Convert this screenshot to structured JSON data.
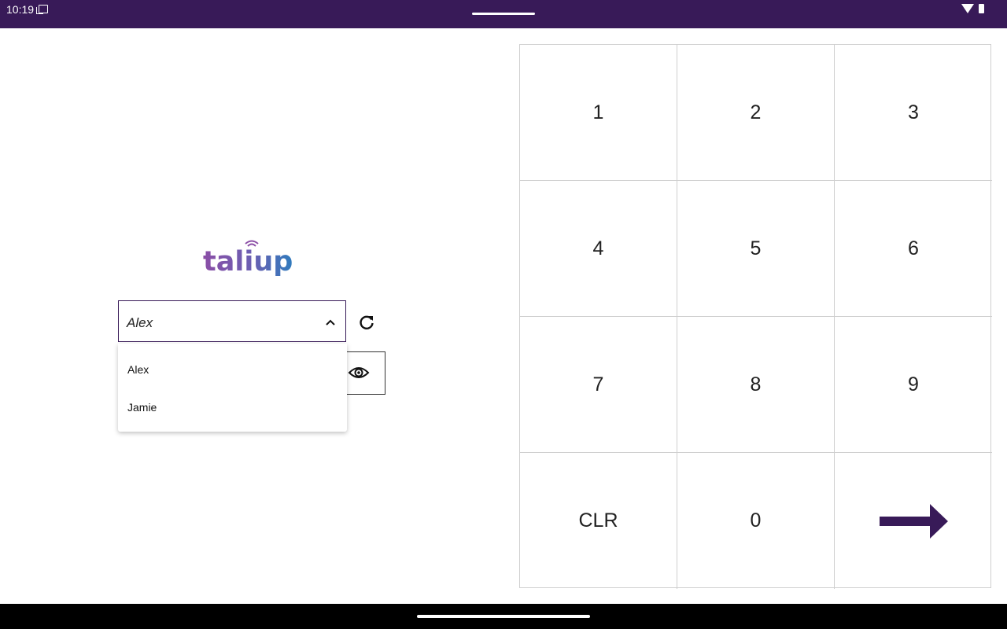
{
  "status_bar": {
    "time": "10:19"
  },
  "login": {
    "logo_text": "taliup",
    "user_select": {
      "selected": "Alex",
      "options": [
        "Alex",
        "Jamie"
      ]
    }
  },
  "keypad": {
    "keys": [
      "1",
      "2",
      "3",
      "4",
      "5",
      "6",
      "7",
      "8",
      "9",
      "CLR",
      "0"
    ]
  },
  "colors": {
    "brand_purple": "#381a58",
    "logo_purple": "#8b4ea6",
    "logo_blue": "#2f7bbd"
  },
  "icons": [
    "refresh-icon",
    "eye-icon",
    "chevron-up-icon",
    "arrow-right-icon",
    "wifi-icon",
    "battery-icon"
  ]
}
